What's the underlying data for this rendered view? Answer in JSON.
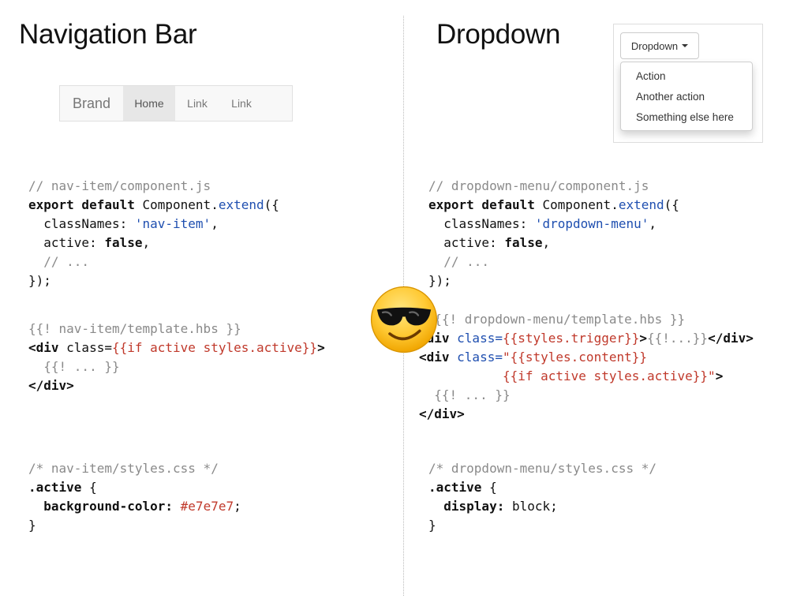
{
  "headings": {
    "left": "Navigation Bar",
    "right": "Dropdown"
  },
  "navbar": {
    "brand": "Brand",
    "items": [
      "Home",
      "Link",
      "Link"
    ],
    "active_index": 0
  },
  "dropdown": {
    "button_label": "Dropdown",
    "items": [
      "Action",
      "Another action",
      "Something else here"
    ]
  },
  "colors": {
    "active_bg": "#e7e7e7",
    "navbar_bg": "#f8f8f8",
    "keyword_blue": "#1f4fb0",
    "template_red": "#c0392b",
    "comment_gray": "#8a8a8a"
  },
  "code": {
    "nav_js": {
      "comment": "// nav-item/component.js",
      "export_kw": "export default",
      "component": " Component.",
      "extend": "extend",
      "open": "({",
      "classnames_key": "  classNames: ",
      "classnames_val": "'nav-item'",
      "comma1": ",",
      "active_key": "  active: ",
      "active_val": "false",
      "comma2": ",",
      "ellipsis": "  // ...",
      "close": "});"
    },
    "nav_hbs": {
      "comment": "{{! nav-item/template.hbs }}",
      "line1_a": "<div",
      "line1_b": " class=",
      "line1_c": "{{if active styles.active}}",
      "line1_d": ">",
      "line2": "  {{! ... }}",
      "line3": "</div>"
    },
    "nav_css": {
      "comment": "/* nav-item/styles.css */",
      "selector": ".active",
      "open": " {",
      "prop": "  background-color:",
      "value": " #e7e7e7",
      "semi": ";",
      "close": "}"
    },
    "dd_js": {
      "comment": "// dropdown-menu/component.js",
      "export_kw": "export default",
      "component": " Component.",
      "extend": "extend",
      "open": "({",
      "classnames_key": "  classNames: ",
      "classnames_val": "'dropdown-menu'",
      "comma1": ",",
      "active_key": "  active: ",
      "active_val": "false",
      "comma2": ",",
      "ellipsis": "  // ...",
      "close": "});"
    },
    "dd_hbs": {
      "comment": "  {{! dropdown-menu/template.hbs }}",
      "l1_a": "<div",
      "l1_b": " class=",
      "l1_c": "{{styles.trigger}}",
      "l1_d": ">",
      "l1_e": "{{!...}}",
      "l1_f": "</div>",
      "l2_a": "<div",
      "l2_b": " class=",
      "l2_c": "\"{{styles.content}}",
      "l3": "           {{if active styles.active}}\"",
      "l3_end": ">",
      "l4": "  {{! ... }}",
      "l5": "</div>"
    },
    "dd_css": {
      "comment": "/* dropdown-menu/styles.css */",
      "selector": ".active",
      "open": " {",
      "prop": "  display:",
      "value": " block",
      "semi": ";",
      "close": "}"
    }
  },
  "decoration": {
    "emoji_icon": "sunglasses-smiley-emoji"
  }
}
